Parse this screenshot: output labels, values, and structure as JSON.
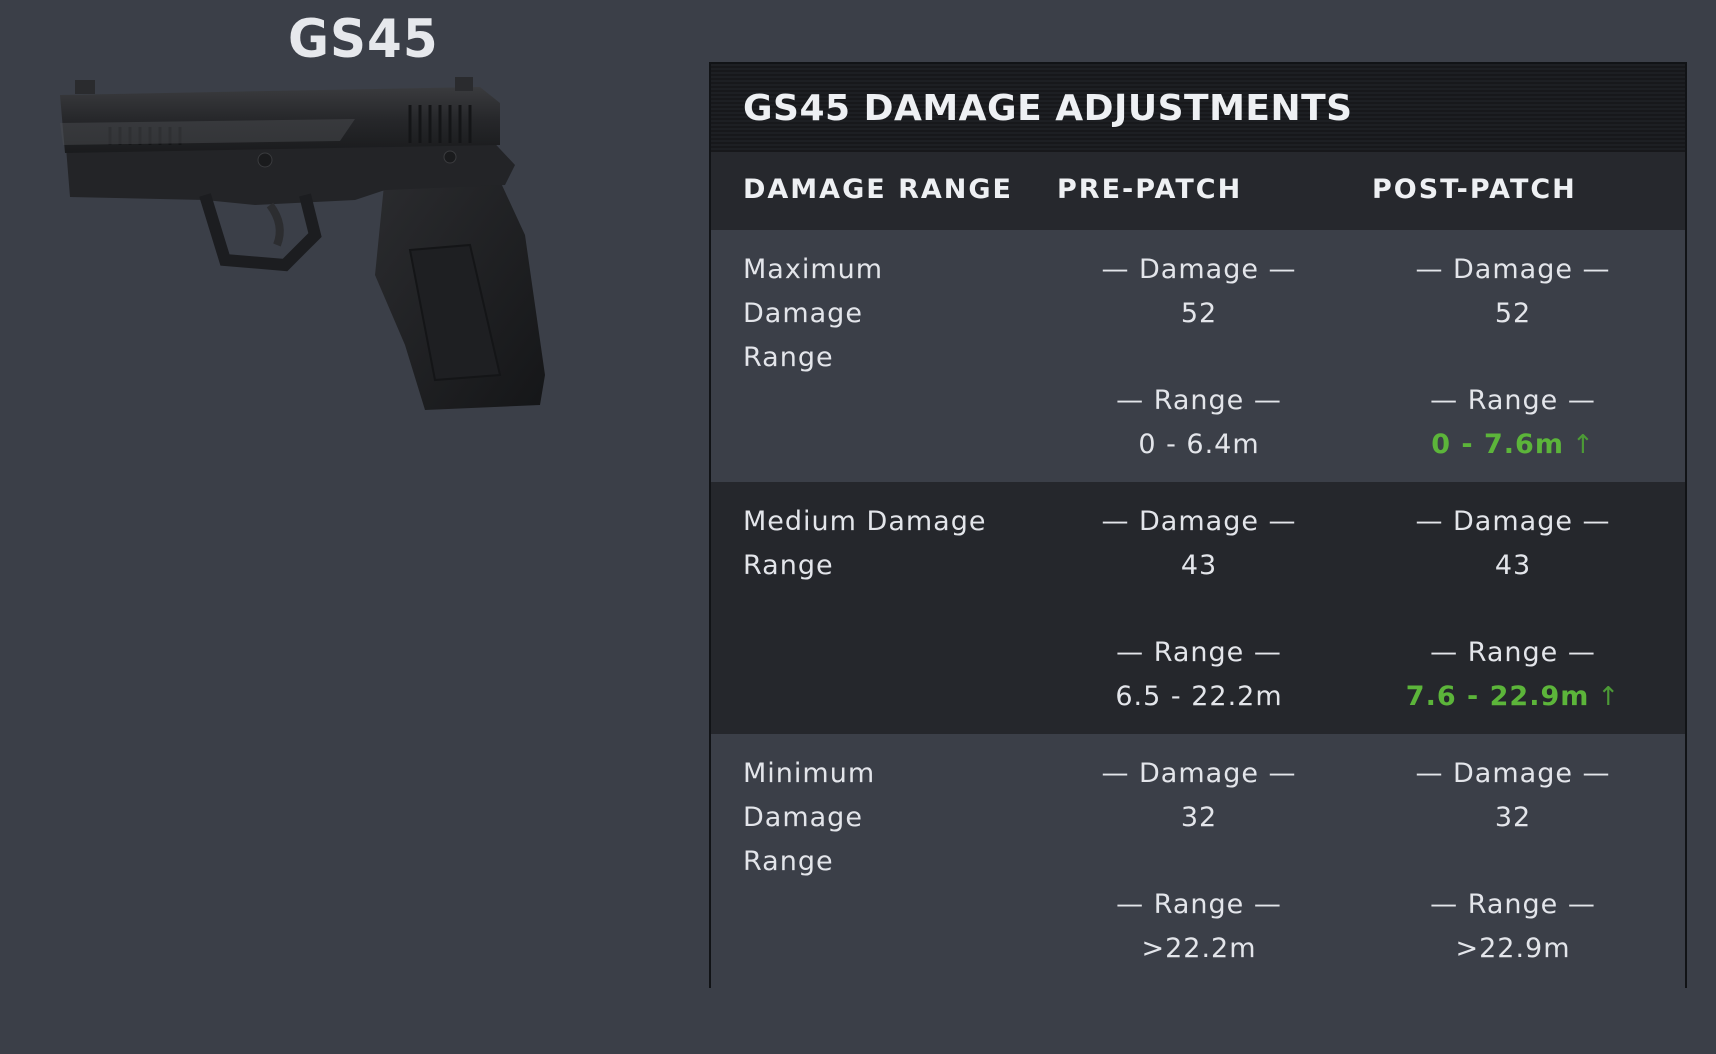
{
  "weapon": {
    "name": "GS45"
  },
  "table": {
    "title": "GS45 DAMAGE ADJUSTMENTS",
    "columns": [
      "DAMAGE RANGE",
      "PRE-PATCH",
      "POST-PATCH"
    ],
    "damage_label": "— Damage —",
    "range_label": "— Range —",
    "rows": [
      {
        "label_line1": "Maximum Damage",
        "label_line2": "Range",
        "pre": {
          "damage": "52",
          "range": "0 - 6.4m"
        },
        "post": {
          "damage": "52",
          "range": "0 - 7.6m",
          "range_increased": true
        }
      },
      {
        "label_line1": "Medium Damage",
        "label_line2": "Range",
        "pre": {
          "damage": "43",
          "range": "6.5 - 22.2m"
        },
        "post": {
          "damage": "43",
          "range": "7.6 - 22.9m",
          "range_increased": true
        }
      },
      {
        "label_line1": "Minimum Damage",
        "label_line2": "Range",
        "pre": {
          "damage": "32",
          "range": ">22.2m"
        },
        "post": {
          "damage": "32",
          "range": ">22.9m",
          "range_increased": false
        }
      }
    ]
  },
  "icons": {
    "weapon_image": "pistol-icon",
    "increase_indicator": "arrow-up-icon"
  },
  "colors": {
    "background": "#3b3f48",
    "dark_row": "#25272c",
    "header_bar": "#1a1b1e",
    "increase_green": "#5cb53a"
  }
}
